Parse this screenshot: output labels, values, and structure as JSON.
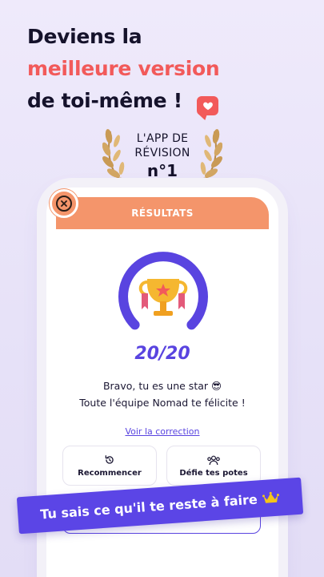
{
  "headline": {
    "line1": "Deviens la",
    "line2": "meilleure version",
    "line3": "de toi-même !"
  },
  "award": {
    "line1": "L'APP DE",
    "line2": "RÉVISION",
    "line3": "n°1"
  },
  "results": {
    "title": "RÉSULTATS",
    "score": "20/20",
    "message_line1": "Bravo, tu es une star 😎",
    "message_line2": "Toute l'équipe Nomad te félicite !",
    "link": "Voir la correction",
    "restart_label": "Recommencer",
    "challenge_label": "Défie tes potes",
    "gauge_fraction": 0.75
  },
  "banner": {
    "text": "Tu sais ce qu'il te reste à faire"
  },
  "colors": {
    "accent_red": "#f25a5a",
    "purple": "#5944e0",
    "orange": "#f4956b",
    "gold": "#f5b730"
  },
  "icons": [
    "heart-icon",
    "laurel-icon",
    "close-icon",
    "trophy-icon",
    "restart-icon",
    "group-icon",
    "crown-icon"
  ]
}
